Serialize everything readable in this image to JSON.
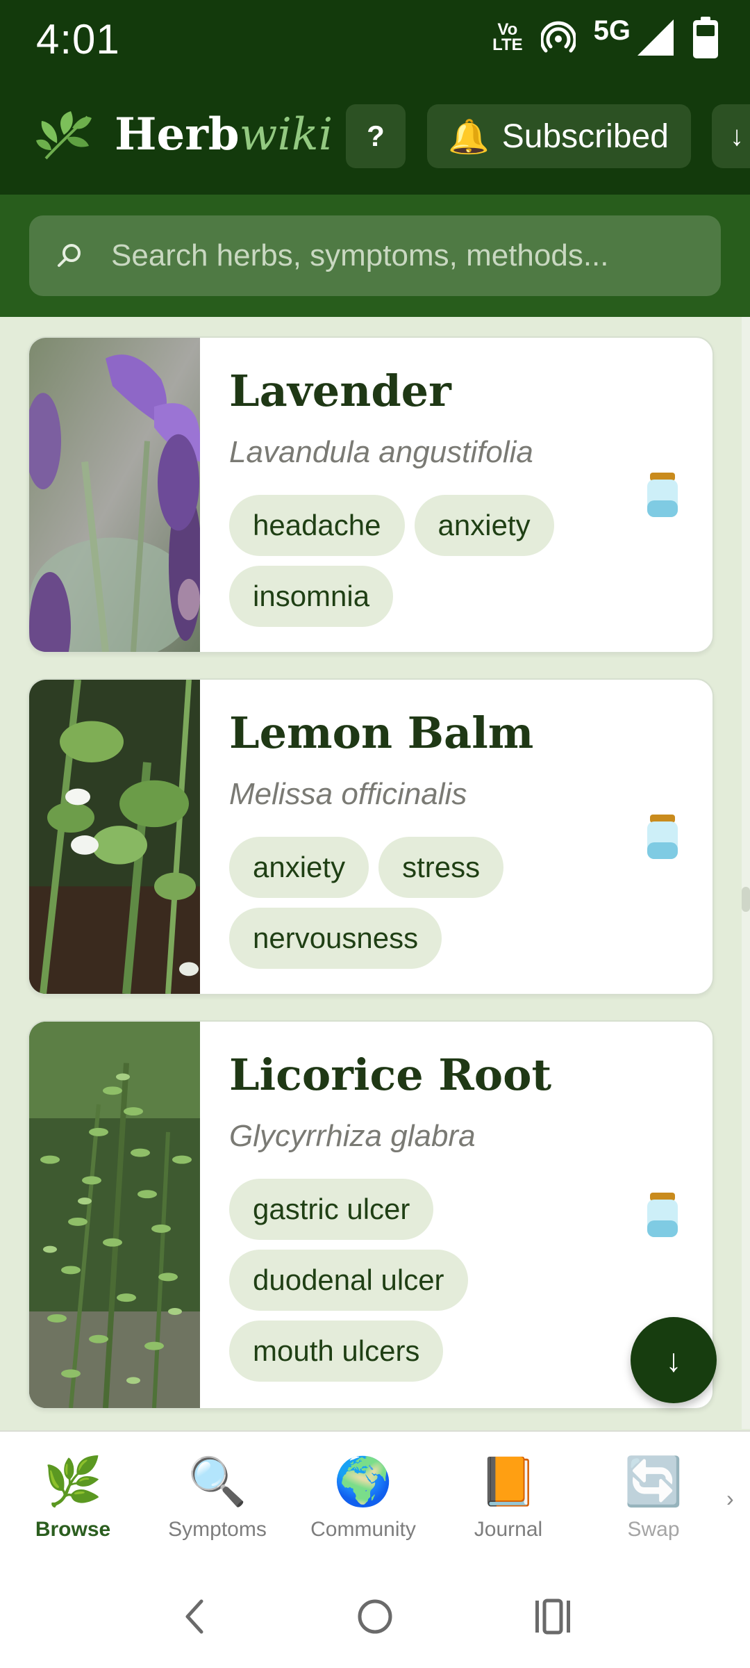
{
  "status_bar": {
    "time": "4:01",
    "volte_line1": "Vo",
    "volte_line2": "LTE",
    "network": "5G",
    "icons": [
      "volte-icon",
      "hotspot-icon",
      "signal-icon",
      "battery-icon"
    ]
  },
  "header": {
    "brand_part1": "Herb",
    "brand_part2": "wiki",
    "logo_icon": "herb-leaf-icon",
    "help_label": "?",
    "subscribed_icon": "🔔",
    "subscribed_label": "Subscribed",
    "more_label": "↓"
  },
  "search": {
    "icon": "⌕",
    "placeholder": "Search herbs, symptoms, methods..."
  },
  "herbs": [
    {
      "name": "Lavender",
      "latin": "Lavandula angustifolia",
      "tags": [
        "headache",
        "anxiety",
        "insomnia"
      ],
      "jar_icon": "jar-icon"
    },
    {
      "name": "Lemon Balm",
      "latin": "Melissa officinalis",
      "tags": [
        "anxiety",
        "stress",
        "nervousness"
      ],
      "jar_icon": "jar-icon"
    },
    {
      "name": "Licorice Root",
      "latin": "Glycyrrhiza glabra",
      "tags": [
        "gastric ulcer",
        "duodenal ulcer",
        "mouth ulcers"
      ],
      "jar_icon": "jar-icon"
    }
  ],
  "fab": {
    "label": "↓"
  },
  "bottom_nav": {
    "items": [
      {
        "icon": "🌿",
        "label": "Browse",
        "active": true
      },
      {
        "icon": "🔍",
        "label": "Symptoms",
        "active": false
      },
      {
        "icon": "🌍",
        "label": "Community",
        "active": false
      },
      {
        "icon": "📙",
        "label": "Journal",
        "active": false
      },
      {
        "icon": "🔄",
        "label": "Swap",
        "active": false
      }
    ],
    "next_label": "›"
  },
  "colors": {
    "header_bg": "#133a0c",
    "search_band": "#285d1c",
    "search_box": "#4f7a44",
    "accent_green": "#93c981",
    "tag_bg": "#e4ecda",
    "page_bg": "#e3ecd9"
  }
}
